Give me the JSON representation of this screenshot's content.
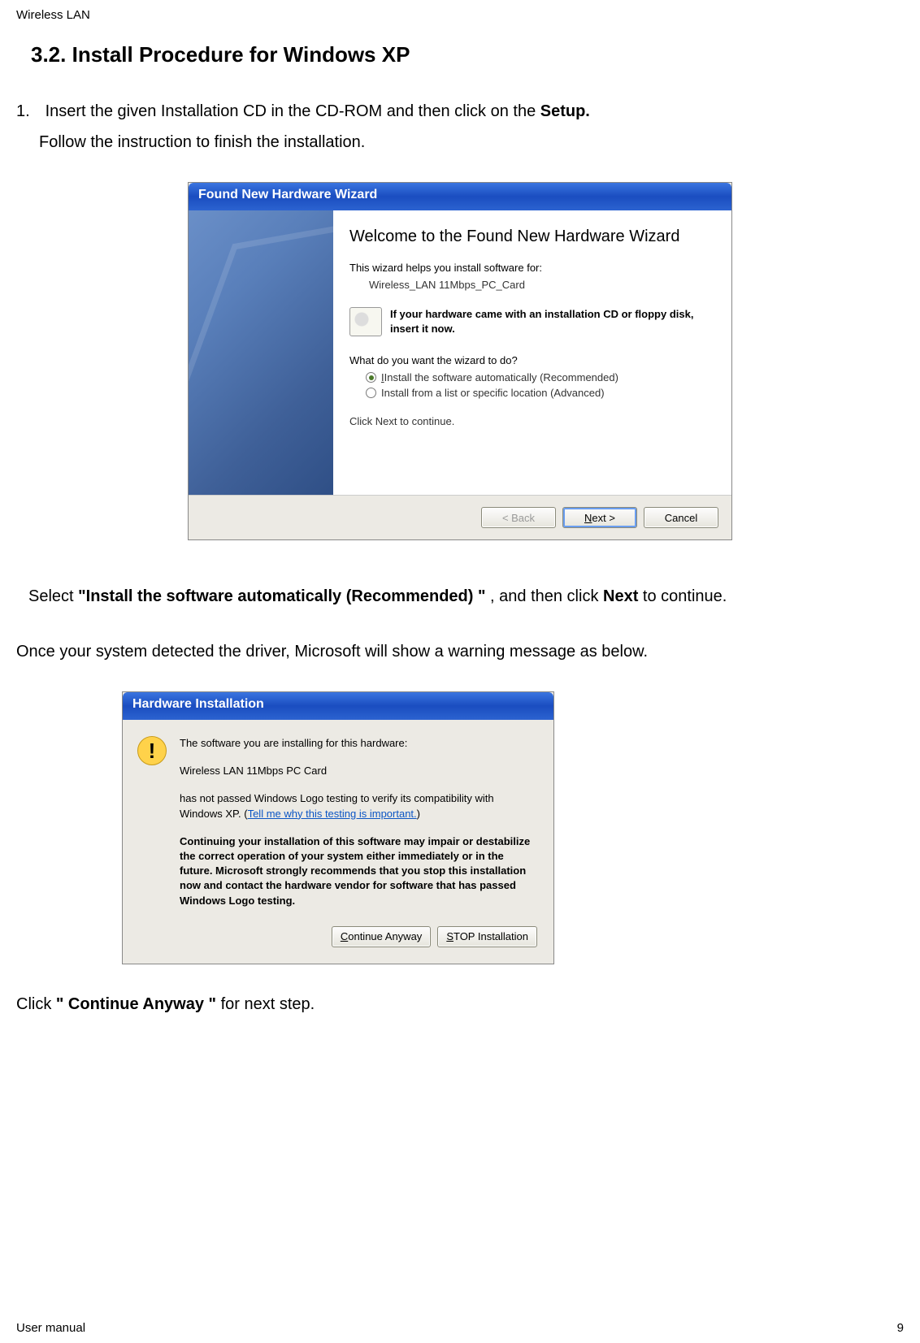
{
  "header": {
    "label": "Wireless LAN"
  },
  "section": {
    "heading": "3.2. Install Procedure for Windows XP"
  },
  "step1": {
    "number": "1.",
    "line1_prefix": "Insert the given Installation CD in the CD-ROM and then click on the ",
    "line1_bold": "Setup.",
    "line2": "Follow the instruction to finish the installation."
  },
  "wizard": {
    "title": "Found New Hardware Wizard",
    "heading": "Welcome to the Found New Hardware Wizard",
    "helps": "This wizard helps you install software for:",
    "device": "Wireless_LAN 11Mbps_PC_Card",
    "cd_text": "If your hardware came with an installation CD or floppy disk, insert it now.",
    "question": "What do you want the wizard to do?",
    "opt_auto_prefix": "Install the software automatically (Recommended)",
    "opt_specific": "Install from a list or specific location (Advanced)",
    "continue_text": "Click Next to continue.",
    "btn_back": "< Back",
    "btn_next": "Next >",
    "btn_cancel": "Cancel"
  },
  "mid_text": {
    "select_prefix": "Select ",
    "select_bold": "\"Install the software automatically (Recommended) \"",
    "select_mid": ", and then click ",
    "select_bold2": "Next",
    "select_suffix": " to continue.",
    "detected": "Once your system detected the driver, Microsoft will show a warning message as below."
  },
  "hw": {
    "title": "Hardware Installation",
    "line1": "The software you are installing for this hardware:",
    "line2": "Wireless LAN 11Mbps PC Card",
    "line3_prefix": "has not passed Windows Logo testing to verify its compatibility with Windows XP. (",
    "line3_link": "Tell me why this testing is important.",
    "line3_suffix": ")",
    "bold_block": "Continuing your installation of this software may impair or destabilize the correct operation of your system either immediately or in the future. Microsoft strongly recommends that you stop this installation now and contact the hardware vendor for software that has passed Windows Logo testing.",
    "btn_continue": "Continue Anyway",
    "btn_stop": "STOP Installation"
  },
  "bottom": {
    "click_prefix": "Click ",
    "click_bold": "\" Continue Anyway \"",
    "click_suffix": " for next step."
  },
  "footer": {
    "left": "User manual",
    "right": "9"
  }
}
